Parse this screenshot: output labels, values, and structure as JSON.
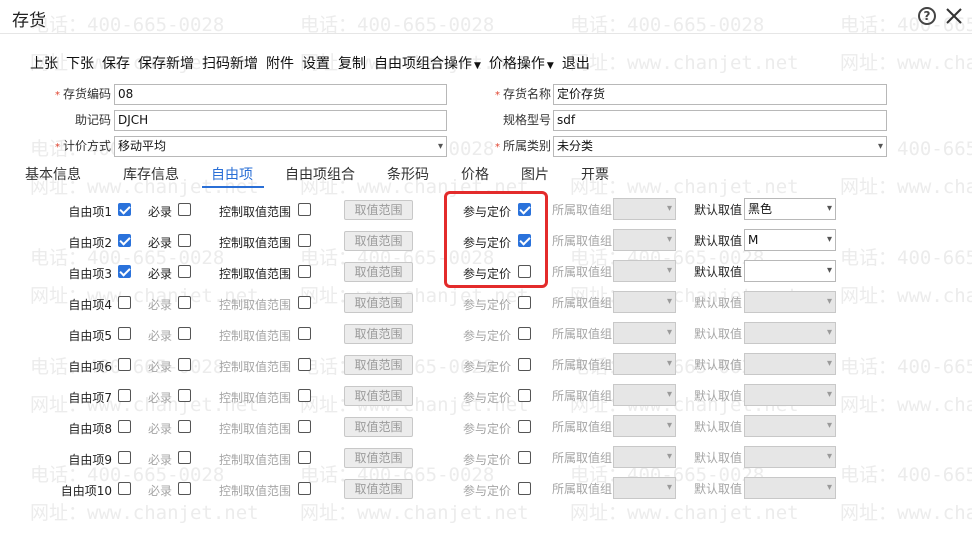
{
  "window": {
    "title": "存货",
    "help_icon": "question-circle-icon",
    "close_icon": "close-icon"
  },
  "watermark": {
    "phone": "电话：400-665-0028",
    "site": "网址：www.chanjet.net"
  },
  "toolbar": {
    "items": [
      {
        "label": "上张"
      },
      {
        "label": "下张"
      },
      {
        "label": "保存"
      },
      {
        "label": "保存新增"
      },
      {
        "label": "扫码新增"
      },
      {
        "label": "附件"
      },
      {
        "label": "设置"
      },
      {
        "label": "复制"
      },
      {
        "label": "自由项组合操作",
        "dropdown": true
      },
      {
        "label": "价格操作",
        "dropdown": true
      },
      {
        "label": "退出"
      }
    ]
  },
  "form": {
    "code": {
      "label": "存货编码",
      "required": true,
      "value": "08"
    },
    "name": {
      "label": "存货名称",
      "required": true,
      "value": "定价存货"
    },
    "mnemonic": {
      "label": "助记码",
      "required": false,
      "value": "DJCH"
    },
    "spec": {
      "label": "规格型号",
      "required": false,
      "value": "sdf"
    },
    "pricing": {
      "label": "计价方式",
      "required": true,
      "value": "移动平均"
    },
    "category": {
      "label": "所属类别",
      "required": true,
      "value": "未分类"
    }
  },
  "tabs": [
    {
      "label": "基本信息",
      "active": false
    },
    {
      "label": "库存信息",
      "active": false
    },
    {
      "label": "自由项",
      "active": true
    },
    {
      "label": "自由项组合",
      "active": false
    },
    {
      "label": "条形码",
      "active": false
    },
    {
      "label": "价格",
      "active": false
    },
    {
      "label": "图片",
      "active": false
    },
    {
      "label": "开票",
      "active": false
    }
  ],
  "free_items": {
    "labels": {
      "required": "必录",
      "control_range": "控制取值范围",
      "range_button": "取值范围",
      "pricing": "参与定价",
      "group": "所属取值组",
      "default_value": "默认取值"
    },
    "rows": [
      {
        "name": "自由项1",
        "enabled": true,
        "required": false,
        "control_range": false,
        "pricing": true,
        "default": "黑色"
      },
      {
        "name": "自由项2",
        "enabled": true,
        "required": false,
        "control_range": false,
        "pricing": true,
        "default": "M"
      },
      {
        "name": "自由项3",
        "enabled": true,
        "required": false,
        "control_range": false,
        "pricing": false,
        "default": ""
      },
      {
        "name": "自由项4",
        "enabled": false,
        "required": false,
        "control_range": false,
        "pricing": false,
        "default": ""
      },
      {
        "name": "自由项5",
        "enabled": false,
        "required": false,
        "control_range": false,
        "pricing": false,
        "default": ""
      },
      {
        "name": "自由项6",
        "enabled": false,
        "required": false,
        "control_range": false,
        "pricing": false,
        "default": ""
      },
      {
        "name": "自由项7",
        "enabled": false,
        "required": false,
        "control_range": false,
        "pricing": false,
        "default": ""
      },
      {
        "name": "自由项8",
        "enabled": false,
        "required": false,
        "control_range": false,
        "pricing": false,
        "default": ""
      },
      {
        "name": "自由项9",
        "enabled": false,
        "required": false,
        "control_range": false,
        "pricing": false,
        "default": ""
      },
      {
        "name": "自由项10",
        "enabled": false,
        "required": false,
        "control_range": false,
        "pricing": false,
        "default": ""
      }
    ]
  },
  "colors": {
    "accent": "#2a6fd6",
    "checkbox": "#2a72db",
    "highlight_border": "#e32b2b",
    "required_mark": "#e0442f"
  }
}
